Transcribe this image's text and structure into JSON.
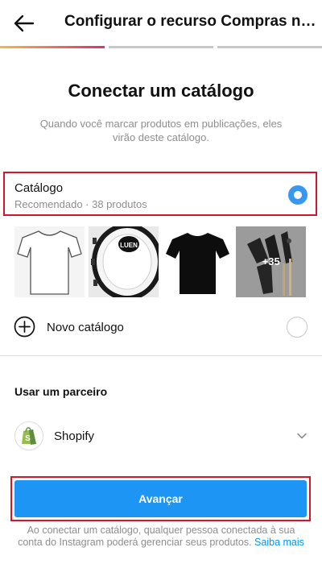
{
  "header": {
    "title": "Configurar o recurso Compras no Instagram",
    "back_icon": "arrow-left-icon",
    "progress": {
      "total_steps": 3,
      "current_step": 1
    }
  },
  "main": {
    "title": "Conectar um catálogo",
    "subtitle": "Quando você marcar produtos em publicações, eles virão deste catálogo.",
    "catalog": {
      "name": "Catálogo",
      "meta": "Recomendado · 38 produtos",
      "selected": true
    },
    "thumbnails": [
      {
        "icon": "white-tshirt-image"
      },
      {
        "icon": "drum-image"
      },
      {
        "icon": "black-tshirt-image"
      },
      {
        "icon": "shakers-image",
        "more_label": "+35"
      }
    ],
    "new_catalog": {
      "label": "Novo catálogo",
      "icon": "plus-circle-icon",
      "selected": false
    }
  },
  "partner": {
    "heading": "Usar um parceiro",
    "name": "Shopify",
    "icon": "shopify-icon"
  },
  "next_button": {
    "label": "Avançar"
  },
  "footer": {
    "text": "Ao conectar um catálogo, qualquer pessoa conectada à sua conta do Instagram poderá gerenciar seus produtos.",
    "link": "Saiba mais"
  },
  "colors": {
    "accent": "#1d95f4",
    "radio": "#3897f0",
    "highlight": "#d3162b"
  }
}
